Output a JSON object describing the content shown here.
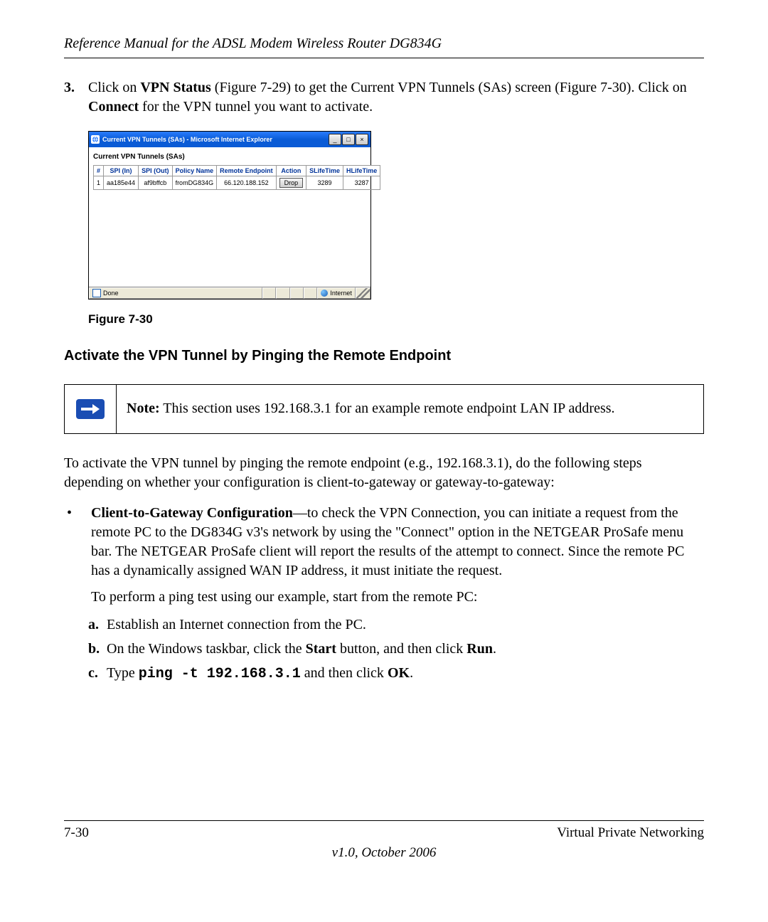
{
  "header": {
    "title": "Reference Manual for the ADSL Modem Wireless Router DG834G"
  },
  "step3": {
    "number": "3.",
    "pre1": "Click on ",
    "bold1": "VPN Status",
    "mid1": " (Figure 7-29) to get the Current VPN Tunnels (SAs) screen (Figure 7-30). Click on ",
    "bold2": "Connect",
    "post1": " for the VPN tunnel you want to activate."
  },
  "ie": {
    "title": "Current VPN Tunnels (SAs) - Microsoft Internet Explorer",
    "section": "Current VPN Tunnels (SAs)",
    "headers": [
      "#",
      "SPI (In)",
      "SPI (Out)",
      "Policy Name",
      "Remote Endpoint",
      "Action",
      "SLifeTime",
      "HLifeTime"
    ],
    "row": {
      "num": "1",
      "spi_in": "aa185e44",
      "spi_out": "af9bffcb",
      "policy": "fromDG834G",
      "endpoint": "66.120.188.152",
      "action": "Drop",
      "slife": "3289",
      "hlife": "3287"
    },
    "status_done": "Done",
    "status_zone": "Internet"
  },
  "figure_caption": "Figure 7-30",
  "subheading": "Activate the VPN Tunnel by Pinging the Remote Endpoint",
  "note": {
    "bold": "Note:",
    "text": " This section uses 192.168.3.1 for an example remote endpoint LAN IP address."
  },
  "para1": "To activate the VPN tunnel by pinging the remote endpoint (e.g., 192.168.3.1), do the following steps depending on whether your configuration is client-to-gateway or gateway-to-gateway:",
  "bullet1": {
    "bold": "Client-to-Gateway Configuration",
    "text": "—to check the VPN Connection, you can initiate a request from the remote PC to the DG834G v3's network by using the \"Connect\" option in the NETGEAR ProSafe menu bar. The NETGEAR ProSafe client will report the results of the attempt to connect. Since the remote PC has a dynamically assigned WAN IP address, it must initiate the request."
  },
  "para2": "To perform a ping test using our example, start from the remote PC:",
  "steps": {
    "a": {
      "label": "a.",
      "text": "Establish an Internet connection from the PC."
    },
    "b": {
      "label": "b.",
      "pre": "On the Windows taskbar, click the ",
      "b1": "Start",
      "mid": " button, and then click ",
      "b2": "Run",
      "post": "."
    },
    "c": {
      "label": "c.",
      "pre": "Type ",
      "cmd": "ping -t 192.168.3.1",
      "mid": " and then click ",
      "b1": "OK",
      "post": "."
    }
  },
  "footer": {
    "left": "7-30",
    "right": "Virtual Private Networking",
    "version": "v1.0, October 2006"
  }
}
